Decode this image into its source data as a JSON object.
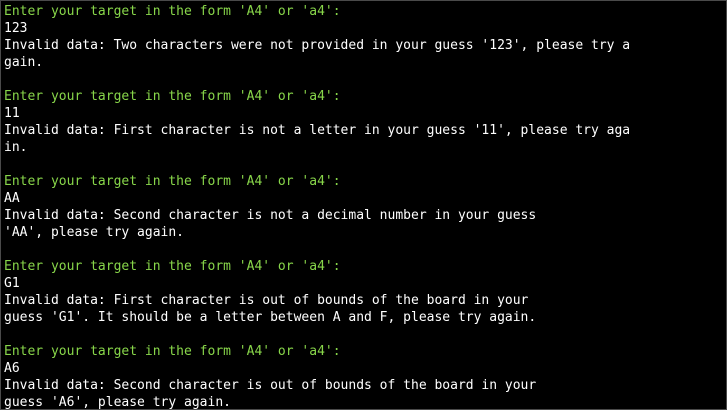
{
  "colors": {
    "background": "#000000",
    "prompt": "#88d64a",
    "text": "#ffffff"
  },
  "blocks": [
    {
      "prompt": "Enter your target in the form 'A4' or 'a4':",
      "input": "123",
      "error_lines": [
        "Invalid data: Two characters were not provided in your guess '123', please try a",
        "gain."
      ]
    },
    {
      "prompt": "Enter your target in the form 'A4' or 'a4':",
      "input": "11",
      "error_lines": [
        "Invalid data: First character is not a letter in your guess '11', please try aga",
        "in."
      ]
    },
    {
      "prompt": "Enter your target in the form 'A4' or 'a4':",
      "input": "AA",
      "error_lines": [
        "Invalid data: Second character is not a decimal number in your guess",
        "'AA', please try again."
      ]
    },
    {
      "prompt": "Enter your target in the form 'A4' or 'a4':",
      "input": "G1",
      "error_lines": [
        "Invalid data: First character is out of bounds of the board in your",
        "guess 'G1'. It should be a letter between A and F, please try again."
      ]
    },
    {
      "prompt": "Enter your target in the form 'A4' or 'a4':",
      "input": "A6",
      "error_lines": [
        "Invalid data: Second character is out of bounds of the board in your",
        "guess 'A6', please try again."
      ]
    }
  ]
}
